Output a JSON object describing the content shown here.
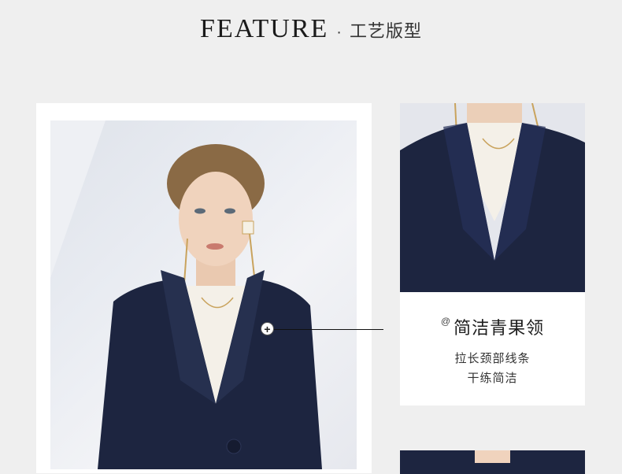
{
  "header": {
    "title_en": "FEATURE",
    "separator": "·",
    "title_cn": "工艺版型"
  },
  "feature": {
    "at_symbol": "@",
    "title": "简洁青果领",
    "lines": [
      "拉长颈部线条",
      "干练简洁"
    ]
  },
  "hotspot": {
    "icon": "plus-icon",
    "glyph": "+"
  },
  "colors": {
    "page_bg": "#efefef",
    "card_bg": "#ffffff",
    "suit_navy": "#1d2540",
    "blouse": "#f4f0e8",
    "text_dark": "#1c1c1c"
  }
}
